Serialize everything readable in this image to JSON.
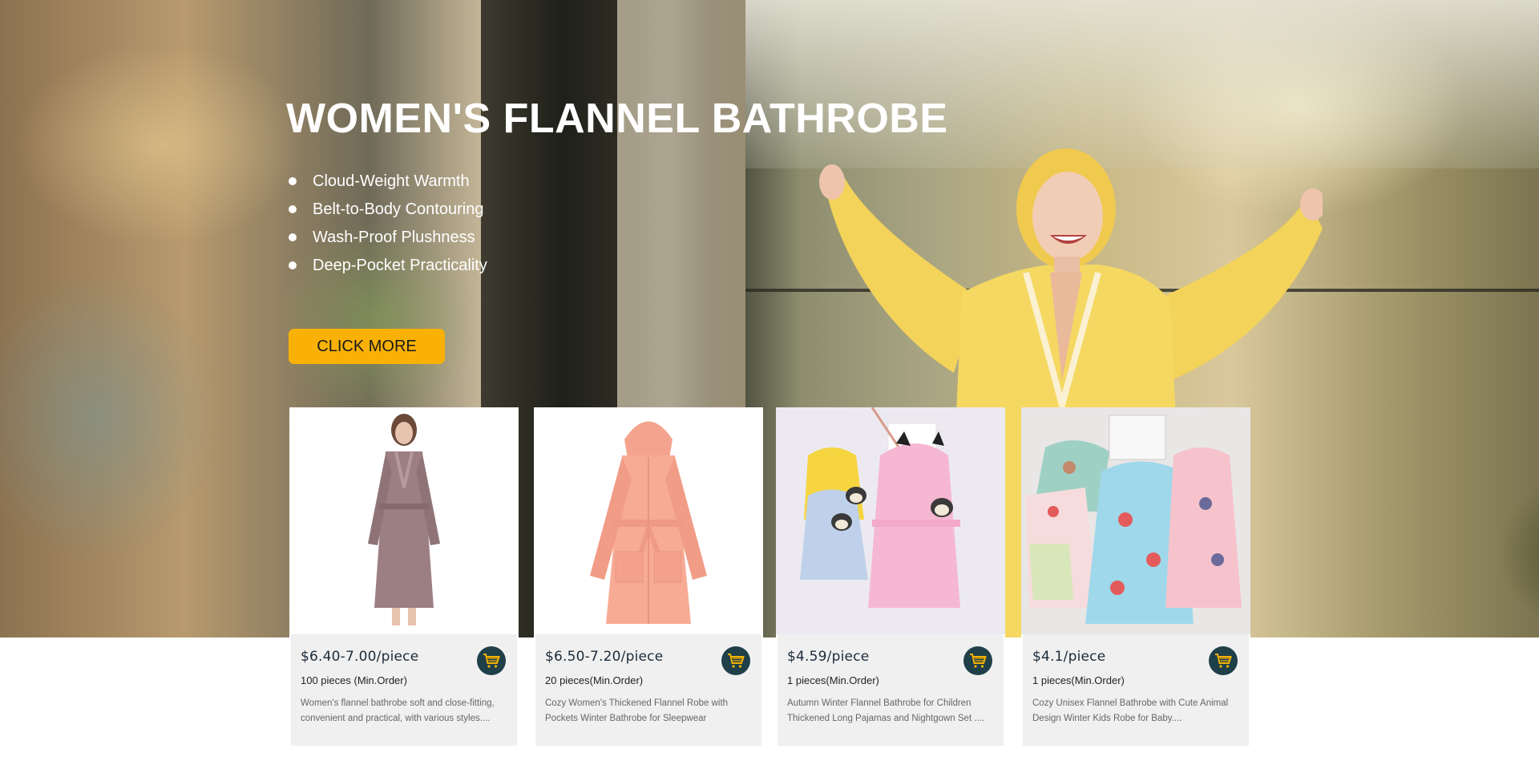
{
  "hero": {
    "title": "WOMEN'S FLANNEL BATHROBE",
    "bullets": [
      "Cloud-Weight Warmth",
      "Belt-to-Body Contouring",
      "Wash-Proof Plushness",
      "Deep-Pocket Practicality"
    ],
    "cta_label": "CLICK MORE"
  },
  "products": [
    {
      "price": "$6.40-7.00/piece",
      "moq": "100 pieces (Min.Order)",
      "description": "Women's flannel bathrobe soft and close-fitting, convenient and practical, with various styles....",
      "icon": "shopping-cart-icon"
    },
    {
      "price": "$6.50-7.20/piece",
      "moq": "20 pieces(Min.Order)",
      "description": "Cozy Women's Thickened Flannel Robe with  Pockets Winter Bathrobe for Sleepwear",
      "icon": "shopping-cart-icon"
    },
    {
      "price": "$4.59/piece",
      "moq": "1 pieces(Min.Order)",
      "description": "Autumn Winter Flannel Bathrobe for Children Thickened Long Pajamas and Nightgown Set ....",
      "icon": "shopping-cart-icon"
    },
    {
      "price": "$4.1/piece",
      "moq": "1 pieces(Min.Order)",
      "description": "Cozy Unisex Flannel Bathrobe with Cute  Animal Design Winter Kids Robe for Baby....",
      "icon": "shopping-cart-icon"
    }
  ],
  "colors": {
    "cta": "#f9b106",
    "cart_button": "#1f3f49",
    "cart_glyph": "#f5b100",
    "card_info_bg": "#f0f0f0"
  }
}
